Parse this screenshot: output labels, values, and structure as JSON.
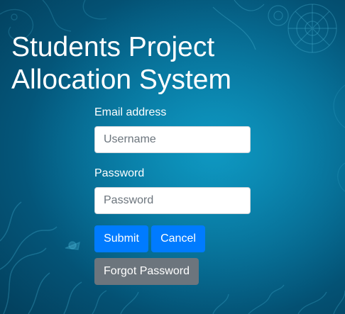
{
  "app": {
    "title": "Students Project\nAllocation System"
  },
  "login_form": {
    "email_label": "Email address",
    "username_placeholder": "Username",
    "username_value": "",
    "password_label": "Password",
    "password_placeholder": "Password",
    "password_value": "",
    "submit_label": "Submit",
    "cancel_label": "Cancel",
    "forgot_label": "Forgot Password"
  },
  "colors": {
    "background": "#056b93",
    "primary_button": "#007bff",
    "secondary_button": "#6c757d",
    "text_light": "#ffffff"
  }
}
